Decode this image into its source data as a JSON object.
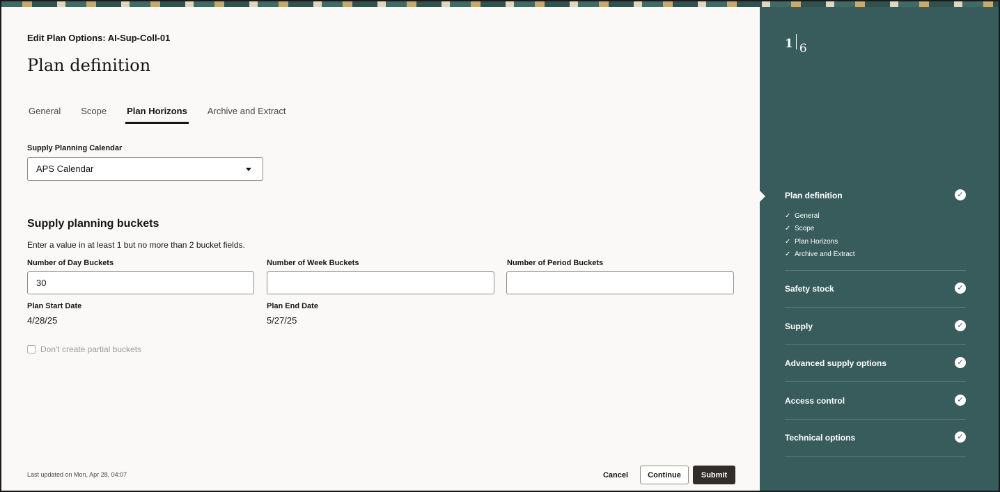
{
  "header": {
    "edit_title": "Edit Plan Options: AI-Sup-Coll-01",
    "page_title": "Plan definition"
  },
  "tabs": [
    {
      "label": "General",
      "active": false
    },
    {
      "label": "Scope",
      "active": false
    },
    {
      "label": "Plan Horizons",
      "active": true
    },
    {
      "label": "Archive and Extract",
      "active": false
    }
  ],
  "calendar": {
    "label": "Supply Planning Calendar",
    "value": "APS Calendar"
  },
  "buckets": {
    "section_title": "Supply planning buckets",
    "instructions": "Enter a value in at least 1 but no more than 2 bucket fields.",
    "day_label": "Number of Day Buckets",
    "day_value": "30",
    "week_label": "Number of Week Buckets",
    "week_value": "",
    "period_label": "Number of Period Buckets",
    "period_value": ""
  },
  "dates": {
    "start_label": "Plan Start Date",
    "start_value": "4/28/25",
    "end_label": "Plan End Date",
    "end_value": "5/27/25"
  },
  "partial_buckets": {
    "label": "Don't create partial buckets",
    "checked": false,
    "disabled": true
  },
  "footer": {
    "last_updated": "Last updated on Mon, Apr 28, 04:07",
    "cancel_label": "Cancel",
    "continue_label": "Continue",
    "submit_label": "Submit"
  },
  "sidebar": {
    "step_current": "1",
    "step_total": "6",
    "steps": [
      {
        "label": "Plan definition",
        "completed": true,
        "current": true,
        "subs": [
          "General",
          "Scope",
          "Plan Horizons",
          "Archive and Extract"
        ]
      },
      {
        "label": "Safety stock",
        "completed": true
      },
      {
        "label": "Supply",
        "completed": true
      },
      {
        "label": "Advanced supply options",
        "completed": true
      },
      {
        "label": "Access control",
        "completed": true
      },
      {
        "label": "Technical options",
        "completed": true
      }
    ]
  },
  "colors": {
    "sidebar_bg": "#385c5c",
    "main_bg": "#fbf9f8",
    "submit_bg": "#312d2a"
  },
  "icons": {
    "calendar_caret": "caret-down-icon",
    "step_complete": "check-circle-icon",
    "sub_complete": "checkmark-icon"
  }
}
